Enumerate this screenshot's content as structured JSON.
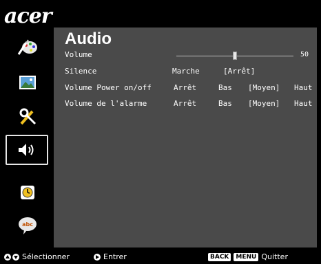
{
  "brand": {
    "logo": "acer"
  },
  "sidebar": {
    "items": [
      {
        "name": "color-settings",
        "icon": "palette-brush-icon",
        "active": false
      },
      {
        "name": "image",
        "icon": "image-icon",
        "active": false
      },
      {
        "name": "management",
        "icon": "tools-icon",
        "active": false
      },
      {
        "name": "audio",
        "icon": "speaker-icon",
        "active": true
      },
      {
        "name": "timer",
        "icon": "clock-icon",
        "active": false
      },
      {
        "name": "language",
        "icon": "abc-speech-icon",
        "active": false
      }
    ]
  },
  "panel": {
    "title": "Audio",
    "rows": {
      "volume": {
        "label": "Volume",
        "value": "50",
        "level_percent": 50
      },
      "silence": {
        "label": "Silence",
        "options": [
          "Marche",
          "[Arrêt]"
        ]
      },
      "volume_power": {
        "label": "Volume Power on/off",
        "options": [
          "Arrêt",
          "Bas",
          "[Moyen]",
          "Haut"
        ]
      },
      "volume_alarm": {
        "label": "Volume de l'alarme",
        "options": [
          "Arrêt",
          "Bas",
          "[Moyen]",
          "Haut"
        ]
      }
    }
  },
  "footer": {
    "select": "Sélectionner",
    "enter": "Entrer",
    "back_key": "BACK",
    "menu_key": "MENU",
    "quit": "Quitter"
  },
  "colors": {
    "panel_bg": "#4a4a4a",
    "background": "#000000",
    "text": "#ffffff"
  }
}
